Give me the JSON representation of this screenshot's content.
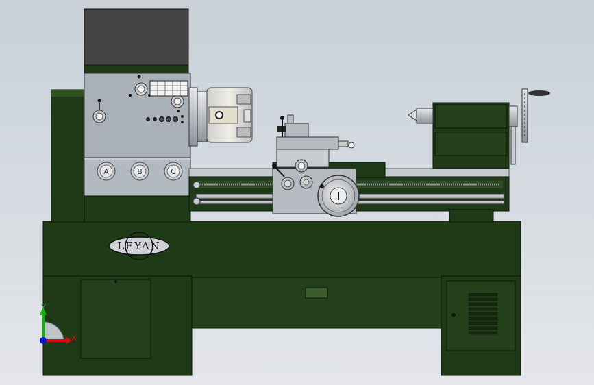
{
  "scene": {
    "brand_badge": "LEYAN",
    "triad": {
      "x_label": "X",
      "y_label": "Y",
      "z_label": "Z"
    },
    "gearbox_dials": [
      "A",
      "B",
      "C"
    ]
  },
  "colors": {
    "background_top": "#c9d0d8",
    "machine_green": "#1f3a16",
    "machine_green_light": "#2e4f22",
    "steel": "#c8ccd0",
    "headstock_grey": "#a9b0b8",
    "axis_x": "#d01010",
    "axis_y": "#10b010",
    "axis_z": "#1010d0"
  }
}
